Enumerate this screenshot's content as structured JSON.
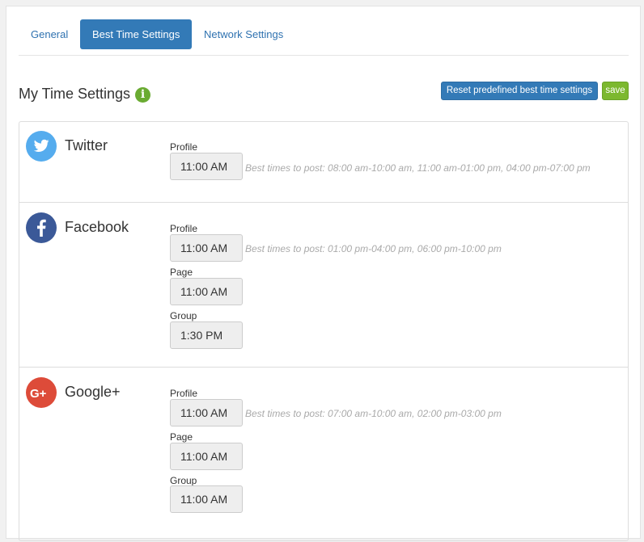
{
  "tabs": [
    "General",
    "Best Time Settings",
    "Network Settings"
  ],
  "header": {
    "title": "My Time Settings",
    "reset_label": "Reset predefined best time settings",
    "save_label": "save"
  },
  "networks": {
    "twitter": {
      "name": "Twitter",
      "profile_label": "Profile",
      "profile_time": "11:00 AM",
      "hint": "Best times to post: 08:00 am-10:00 am, 11:00 am-01:00 pm, 04:00 pm-07:00 pm"
    },
    "facebook": {
      "name": "Facebook",
      "profile_label": "Profile",
      "profile_time": "11:00 AM",
      "page_label": "Page",
      "page_time": "11:00 AM",
      "group_label": "Group",
      "group_time": "1:30 PM",
      "hint": "Best times to post: 01:00 pm-04:00 pm, 06:00 pm-10:00 pm"
    },
    "googleplus": {
      "name": "Google+",
      "profile_label": "Profile",
      "profile_time": "11:00 AM",
      "page_label": "Page",
      "page_time": "11:00 AM",
      "group_label": "Group",
      "group_time": "11:00 AM",
      "hint": "Best times to post: 07:00 am-10:00 am, 02:00 pm-03:00 pm"
    }
  },
  "colors": {
    "primary": "#337ab7",
    "save": "#7cb82f",
    "info": "#6aab32",
    "twitter": "#55acee",
    "facebook": "#3b5998",
    "googleplus": "#dd4b39"
  },
  "icons": {
    "info": "info-icon",
    "twitter": "twitter-bird-icon",
    "facebook": "facebook-f-icon",
    "googleplus": "google-plus-icon"
  }
}
